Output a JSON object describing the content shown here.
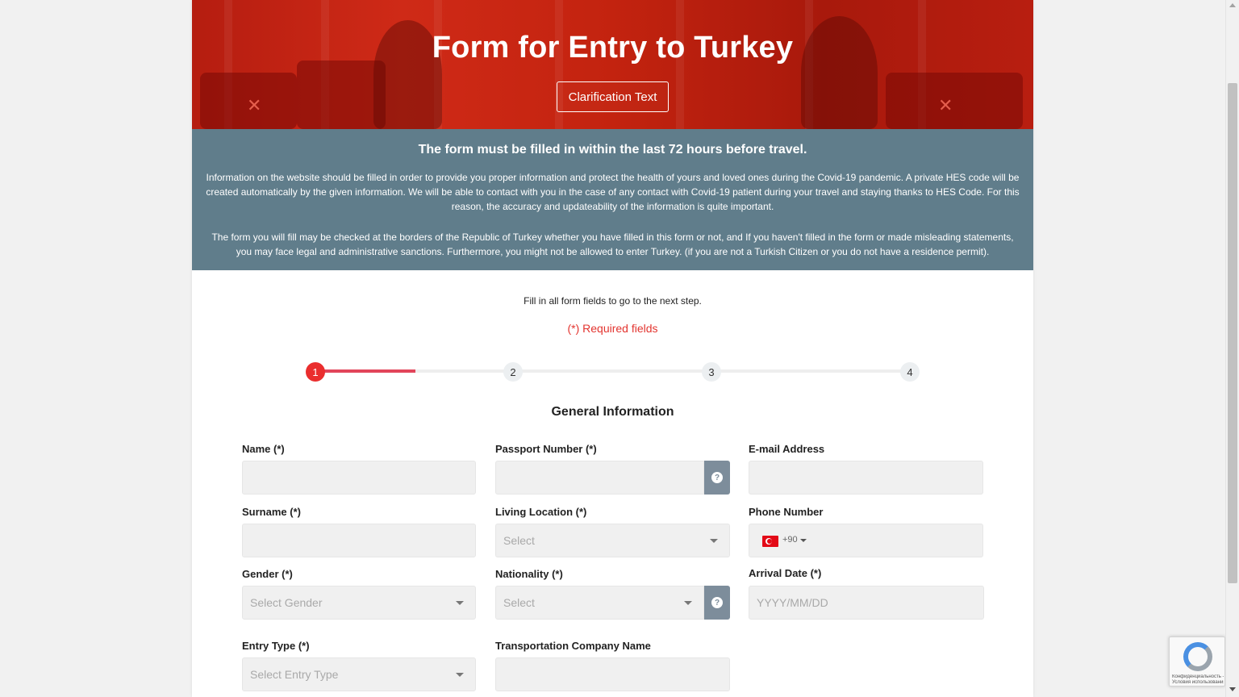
{
  "hero": {
    "title": "Form for Entry to Turkey",
    "clarification_button": "Clarification Text"
  },
  "info": {
    "heading": "The form must be filled in within the last 72 hours before travel.",
    "paragraph1": "Information on the website should be filled in order to provide you proper information and protect the health of yours and loved ones during the Covid-19 pandemic. A private HES code will be created automatically by the given information. We will be able to contact with you in the case of any contact with Covid-19 patient during your travel and staying thanks to HES Code. For this reason, the accuracy and updateability of the information is quite important.",
    "paragraph2": "The form you will fill may be checked at the borders of the Republic of Turkey whether you have filled in this form or not, and If you haven't filled in the form or made misleading statements, you may face legal and administrative sanctions. Furthermore, you might not be allowed to enter Turkey. (if you are not a Turkish Citizen or you do not have a residence permit)."
  },
  "notes": {
    "fill_all": "Fill in all form fields to go to the next step.",
    "required": "(*) Required fields"
  },
  "stepper": {
    "steps": [
      "1",
      "2",
      "3",
      "4"
    ],
    "current": 1,
    "progress": 0.25
  },
  "section_title": "General Information",
  "form": {
    "name_label": "Name (*)",
    "passport_label": "Passport Number (*)",
    "email_label": "E-mail Address",
    "surname_label": "Surname (*)",
    "living_location_label": "Living Location (*)",
    "living_location_placeholder": "Select",
    "phone_label": "Phone Number",
    "phone_dial_code": "+90",
    "gender_label": "Gender (*)",
    "gender_placeholder": "Select Gender",
    "nationality_label": "Nationality (*)",
    "nationality_placeholder": "Select",
    "arrival_label": "Arrival Date (*)",
    "arrival_placeholder": "YYYY/MM/DD",
    "entry_type_label": "Entry Type (*)",
    "entry_type_placeholder": "Select Entry Type",
    "transport_label": "Transportation Company Name"
  },
  "icons": {
    "help": "question-circle-icon",
    "flag": "turkey-flag-icon",
    "dropdown": "caret-down-icon"
  },
  "help_glyph": "?",
  "recaptcha": {
    "text_line1": "Конфиденциальность -",
    "text_line2": "Условия использования"
  },
  "colors": {
    "hero_red": "#c3230f",
    "info_band": "#607d8b",
    "required_red": "#e3342f",
    "step_active": "#ea2e2e",
    "help_button": "#7d8d9b"
  }
}
